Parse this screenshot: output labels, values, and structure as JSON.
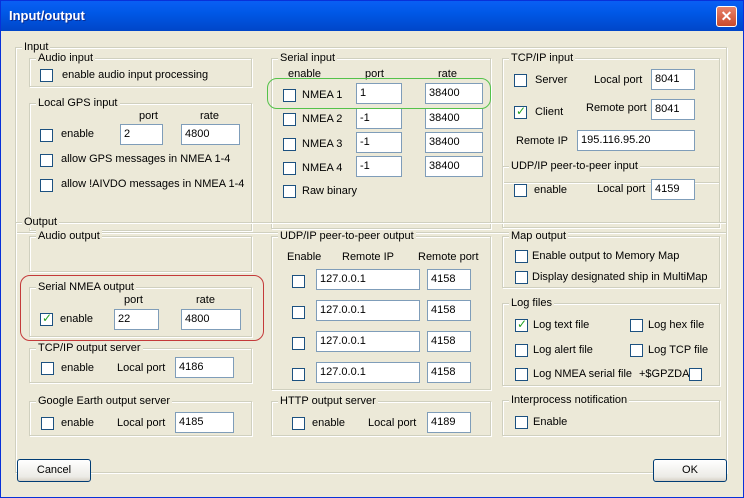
{
  "window": {
    "title": "Input/output",
    "close_symbol": "✕"
  },
  "input": {
    "label": "Input",
    "audio_input": {
      "label": "Audio input",
      "enable_label": "enable audio input processing",
      "enabled": false
    },
    "local_gps": {
      "label": "Local GPS input",
      "port_header": "port",
      "rate_header": "rate",
      "enable_label": "enable",
      "enabled": false,
      "port": "2",
      "rate": "4800",
      "allow_gps_label": "allow GPS messages in NMEA 1-4",
      "allow_aivdo_label": "allow !AIVDO messages in NMEA 1-4"
    },
    "serial": {
      "label": "Serial input",
      "enable_header": "enable",
      "port_header": "port",
      "rate_header": "rate",
      "rows": [
        {
          "name": "NMEA 1",
          "enabled": false,
          "port": "1",
          "rate": "38400"
        },
        {
          "name": "NMEA 2",
          "enabled": false,
          "port": "-1",
          "rate": "38400"
        },
        {
          "name": "NMEA 3",
          "enabled": false,
          "port": "-1",
          "rate": "38400"
        },
        {
          "name": "NMEA 4",
          "enabled": false,
          "port": "-1",
          "rate": "38400"
        }
      ],
      "raw_binary_label": "Raw binary"
    },
    "tcp": {
      "label": "TCP/IP input",
      "server_label": "Server",
      "server_checked": false,
      "local_port_label": "Local port",
      "local_port": "8041",
      "client_label": "Client",
      "client_checked": true,
      "remote_port_label": "Remote port",
      "remote_port": "8041",
      "remote_ip_label": "Remote IP",
      "remote_ip": "195.116.95.20"
    },
    "udp_p2p": {
      "label": "UDP/IP peer-to-peer input",
      "enable_label": "enable",
      "local_port_label": "Local port",
      "local_port": "4159"
    }
  },
  "output": {
    "label": "Output",
    "audio_output": {
      "label": "Audio output"
    },
    "serial_nmea": {
      "label": "Serial NMEA output",
      "port_header": "port",
      "rate_header": "rate",
      "enable_label": "enable",
      "enabled": true,
      "port": "22",
      "rate": "4800"
    },
    "tcp_server": {
      "label": "TCP/IP output server",
      "enable_label": "enable",
      "local_port_label": "Local port",
      "local_port": "4186"
    },
    "google_earth": {
      "label": "Google Earth output server",
      "enable_label": "enable",
      "local_port_label": "Local port",
      "local_port": "4185"
    },
    "udp_p2p": {
      "label": "UDP/IP peer-to-peer output",
      "enable_header": "Enable",
      "remote_ip_header": "Remote IP",
      "remote_port_header": "Remote port",
      "rows": [
        {
          "ip": "127.0.0.1",
          "port": "4158"
        },
        {
          "ip": "127.0.0.1",
          "port": "4158"
        },
        {
          "ip": "127.0.0.1",
          "port": "4158"
        },
        {
          "ip": "127.0.0.1",
          "port": "4158"
        }
      ]
    },
    "http_server": {
      "label": "HTTP output server",
      "enable_label": "enable",
      "local_port_label": "Local port",
      "local_port": "4189"
    },
    "map_output": {
      "label": "Map output",
      "memory_map_label": "Enable output to Memory Map",
      "multimap_label": "Display designated ship in MultiMap"
    },
    "log_files": {
      "label": "Log files",
      "text_label": "Log text file",
      "hex_label": "Log hex file",
      "alert_label": "Log alert file",
      "tcp_label": "Log TCP file",
      "nmea_label": "Log NMEA serial file",
      "gpzda_label": "+$GPZDA"
    },
    "interprocess": {
      "label": "Interprocess notification",
      "enable_label": "Enable"
    }
  },
  "buttons": {
    "cancel": "Cancel",
    "ok": "OK"
  },
  "colors": {
    "title_bar": "#0058e6",
    "highlight_green": "#55c24a",
    "highlight_red": "#c43a3a"
  }
}
